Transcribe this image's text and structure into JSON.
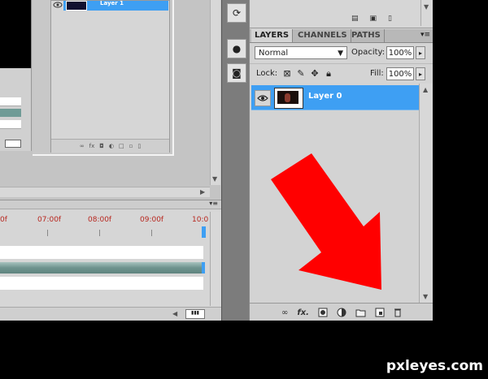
{
  "colors": {
    "selection": "#3e9ff3",
    "arrow": "#ff0000",
    "timecode": "#b8261e",
    "teal_track": "#6f9b96"
  },
  "inner_layers_panel": {
    "selected_layer_label": "Layer 1"
  },
  "timeline": {
    "ticks": [
      "0f",
      "07:00f",
      "08:00f",
      "09:00f",
      "10:0"
    ]
  },
  "layers_panel": {
    "tabs": [
      {
        "label": "LAYERS",
        "active": true
      },
      {
        "label": "CHANNELS",
        "active": false
      },
      {
        "label": "PATHS",
        "active": false
      }
    ],
    "blend_mode": "Normal",
    "opacity_label": "Opacity:",
    "opacity_value": "100%",
    "lock_label": "Lock:",
    "fill_label": "Fill:",
    "fill_value": "100%",
    "layers": [
      {
        "name": "Layer 0",
        "visible": true,
        "selected": true
      }
    ],
    "bottom_icons": [
      "link-icon",
      "fx-icon",
      "mask-icon",
      "adjustment-icon",
      "folder-icon",
      "new-layer-icon",
      "trash-icon"
    ],
    "fx_label": "fx."
  },
  "watermark": "pxleyes.com"
}
